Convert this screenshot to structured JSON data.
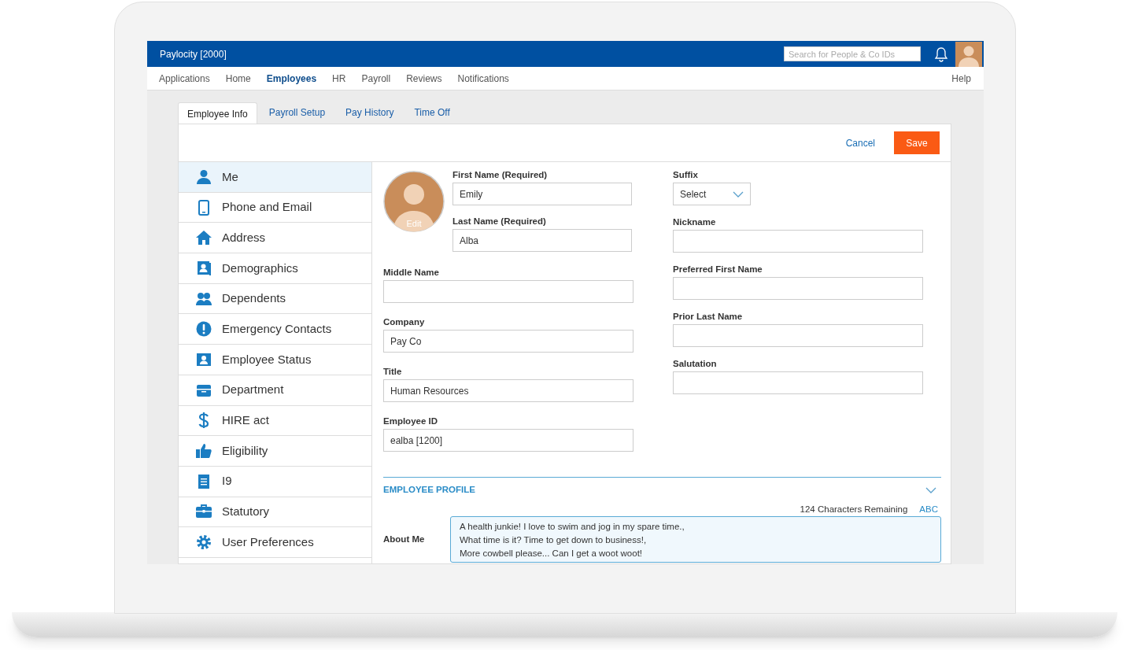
{
  "app": {
    "title": "Paylocity [2000]",
    "search": {
      "placeholder": "Search for People & Co IDs"
    }
  },
  "nav": [
    {
      "label": "Applications",
      "selected": false
    },
    {
      "label": "Home",
      "selected": false
    },
    {
      "label": "Employees",
      "selected": true
    },
    {
      "label": "HR",
      "selected": false
    },
    {
      "label": "Payroll",
      "selected": false
    },
    {
      "label": "Reviews",
      "selected": false
    },
    {
      "label": "Notifications",
      "selected": false
    }
  ],
  "help": "Help",
  "tabs": [
    {
      "label": "Employee Info",
      "selected": true
    },
    {
      "label": "Payroll Setup",
      "selected": false
    },
    {
      "label": "Pay History",
      "selected": false
    },
    {
      "label": "Time Off",
      "selected": false
    }
  ],
  "actions": {
    "cancel": "Cancel",
    "save": "Save"
  },
  "sidebar": {
    "items": [
      {
        "label": "Me",
        "kind": "person",
        "selected": true
      },
      {
        "label": "Phone and Email",
        "kind": "phone",
        "selected": false
      },
      {
        "label": "Address",
        "kind": "home",
        "selected": false
      },
      {
        "label": "Demographics",
        "kind": "card",
        "selected": false
      },
      {
        "label": "Dependents",
        "kind": "people",
        "selected": false
      },
      {
        "label": "Emergency Contacts",
        "kind": "alert",
        "selected": false
      },
      {
        "label": "Employee Status",
        "kind": "badge",
        "selected": false
      },
      {
        "label": "Department",
        "kind": "tray",
        "selected": false
      },
      {
        "label": "HIRE act",
        "kind": "dollar",
        "selected": false
      },
      {
        "label": "Eligibility",
        "kind": "thumb",
        "selected": false
      },
      {
        "label": "I9",
        "kind": "document",
        "selected": false
      },
      {
        "label": "Statutory",
        "kind": "briefcase",
        "selected": false
      },
      {
        "label": "User Preferences",
        "kind": "gear",
        "selected": false
      }
    ]
  },
  "photo": {
    "edit": "Edit"
  },
  "name_fields": [
    {
      "label": "First Name (Required)",
      "value": "Emily"
    },
    {
      "label": "Last Name (Required)",
      "value": "Alba"
    }
  ],
  "left_fields": [
    {
      "label": "Middle Name"
    },
    {
      "label": "Company",
      "value": "Pay Co"
    },
    {
      "label": "Title",
      "value": "Human Resources"
    },
    {
      "label": "Employee ID",
      "value": "ealba [1200]"
    }
  ],
  "right_fields": [
    {
      "label": "Suffix",
      "kind": "select",
      "value": "Select"
    },
    {
      "label": "Nickname",
      "kind": "text"
    },
    {
      "label": "Preferred First Name",
      "kind": "text"
    },
    {
      "label": "Prior Last Name",
      "kind": "text"
    },
    {
      "label": "Salutation",
      "kind": "text"
    }
  ],
  "profile": {
    "heading": "EMPLOYEE PROFILE",
    "expanded": true,
    "counter": "124 Characters Remaining",
    "spellcheck": "ABC",
    "about_label": "About Me",
    "about_lines": [
      "A health junkie! I love to swim and jog in my spare time.,",
      "What time is it? Time to get down to business!,",
      "More cowbell please... Can I get a woot woot!"
    ]
  }
}
